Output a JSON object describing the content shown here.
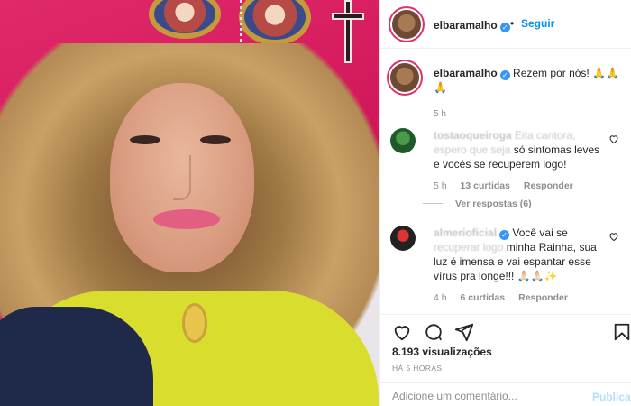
{
  "post": {
    "username": "elbaramalho",
    "follow_label": "Seguir",
    "dot": "•"
  },
  "caption": {
    "username": "elbaramalho",
    "text": "Rezem por nós! 🙏🙏🙏",
    "time": "5 h"
  },
  "comments": [
    {
      "username": "tostaoqueiroga",
      "text_blurred": "Eita cantora, espero que seja",
      "text": "só sintomas leves e vocês se recuperem logo!",
      "time": "5 h",
      "likes": "13 curtidas",
      "reply": "Responder",
      "view_replies": "Ver respostas (6)"
    },
    {
      "username": "almerioficial",
      "text_blurred": "recuperar logo",
      "text_start": "Você vai se",
      "text": "minha Rainha, sua luz é imensa e vai espantar esse vírus pra longe!!! 🙏🏻🙏🏻✨",
      "time": "4 h",
      "likes": "6 curtidas",
      "reply": "Responder"
    }
  ],
  "actions": {
    "views": "8.193 visualizações",
    "ago": "HÁ 5 HORAS",
    "comment_placeholder": "Adicione um comentário...",
    "publish_label": "Publicar"
  },
  "colors": {
    "accent": "#0095f6",
    "verified": "#3897f0",
    "muted": "#8e8e8e",
    "background_wall": "#d81c5e"
  }
}
